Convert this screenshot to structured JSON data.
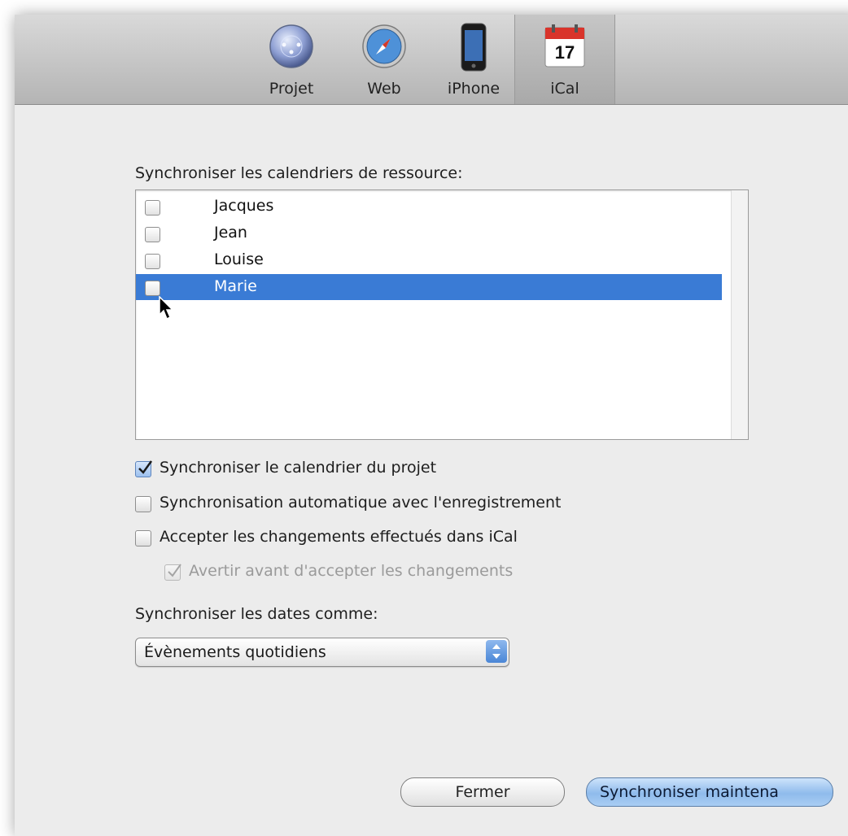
{
  "toolbar": {
    "items": [
      {
        "label": "Projet",
        "icon": "project-globe-icon"
      },
      {
        "label": "Web",
        "icon": "safari-compass-icon"
      },
      {
        "label": "iPhone",
        "icon": "iphone-icon"
      },
      {
        "label": "iCal",
        "icon": "ical-calendar-icon",
        "day": "17",
        "selected": true
      }
    ]
  },
  "resources": {
    "label": "Synchroniser les calendriers de ressource:",
    "items": [
      {
        "name": "Jacques",
        "checked": false,
        "selected": false
      },
      {
        "name": "Jean",
        "checked": false,
        "selected": false
      },
      {
        "name": "Louise",
        "checked": false,
        "selected": false
      },
      {
        "name": "Marie",
        "checked": false,
        "selected": true
      }
    ]
  },
  "options": {
    "sync_project_calendar": {
      "label": "Synchroniser le calendrier du projet",
      "checked": true
    },
    "auto_sync_on_save": {
      "label": "Synchronisation automatique avec l'enregistrement",
      "checked": false
    },
    "accept_ical_changes": {
      "label": "Accepter les changements effectués dans iCal",
      "checked": false
    },
    "warn_before_accept": {
      "label": "Avertir avant d'accepter les changements",
      "checked": true,
      "enabled": false
    }
  },
  "dates": {
    "label": "Synchroniser les dates comme:",
    "selected": "Évènements quotidiens"
  },
  "buttons": {
    "close": "Fermer",
    "sync_now": "Synchroniser maintena"
  },
  "colors": {
    "selection": "#3a7bd5",
    "default_button": "#8fbbec"
  }
}
